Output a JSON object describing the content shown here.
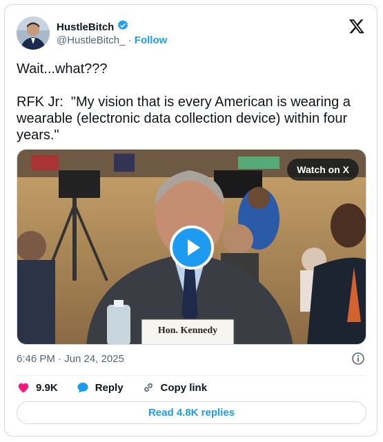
{
  "author": {
    "name": "HustleBitch",
    "handle": "@HustleBitch_",
    "separator": "·",
    "follow_label": "Follow"
  },
  "tweet": {
    "text": "Wait...what???\n\nRFK Jr:  \"My vision that is every American is wearing a wearable (electronic data collection device) within four years.\""
  },
  "media": {
    "watch_label": "Watch on X",
    "nameplate": "Hon. Kennedy"
  },
  "meta": {
    "timestamp": "6:46 PM · Jun 24, 2025"
  },
  "actions": {
    "likes": "9.9K",
    "reply_label": "Reply",
    "copy_link_label": "Copy link"
  },
  "read_replies_label": "Read 4.8K replies",
  "colors": {
    "accent": "#1d9bf0",
    "like": "#f91880",
    "text": "#0f1419",
    "muted": "#536471"
  }
}
